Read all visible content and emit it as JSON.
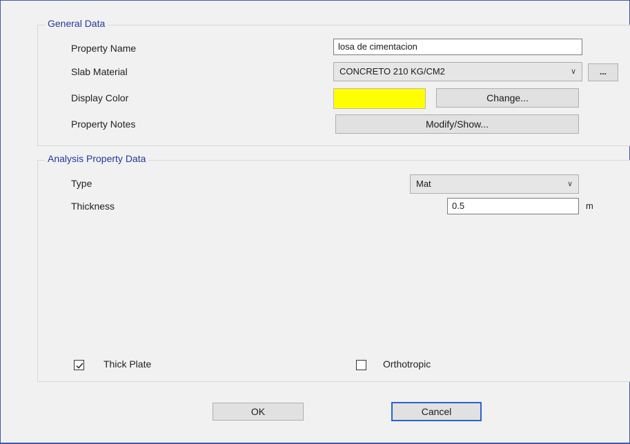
{
  "general": {
    "title": "General Data",
    "property_name_label": "Property Name",
    "property_name_value": "losa de cimentacion",
    "slab_material_label": "Slab Material",
    "slab_material_value": "CONCRETO 210 KG/CM2",
    "slab_material_more": "...",
    "display_color_label": "Display Color",
    "display_color_hex": "#ffff00",
    "change_label": "Change...",
    "property_notes_label": "Property Notes",
    "modify_show_label": "Modify/Show..."
  },
  "analysis": {
    "title": "Analysis Property Data",
    "type_label": "Type",
    "type_value": "Mat",
    "thickness_label": "Thickness",
    "thickness_value": "0.5",
    "thickness_unit": "m",
    "thick_plate_label": "Thick Plate",
    "thick_plate_checked": true,
    "orthotropic_label": "Orthotropic",
    "orthotropic_checked": false
  },
  "buttons": {
    "ok": "OK",
    "cancel": "Cancel"
  },
  "colors": {
    "group_title": "#1f3a9a",
    "frame_border": "#3b5ba8",
    "default_button_border": "#2a63c9"
  }
}
